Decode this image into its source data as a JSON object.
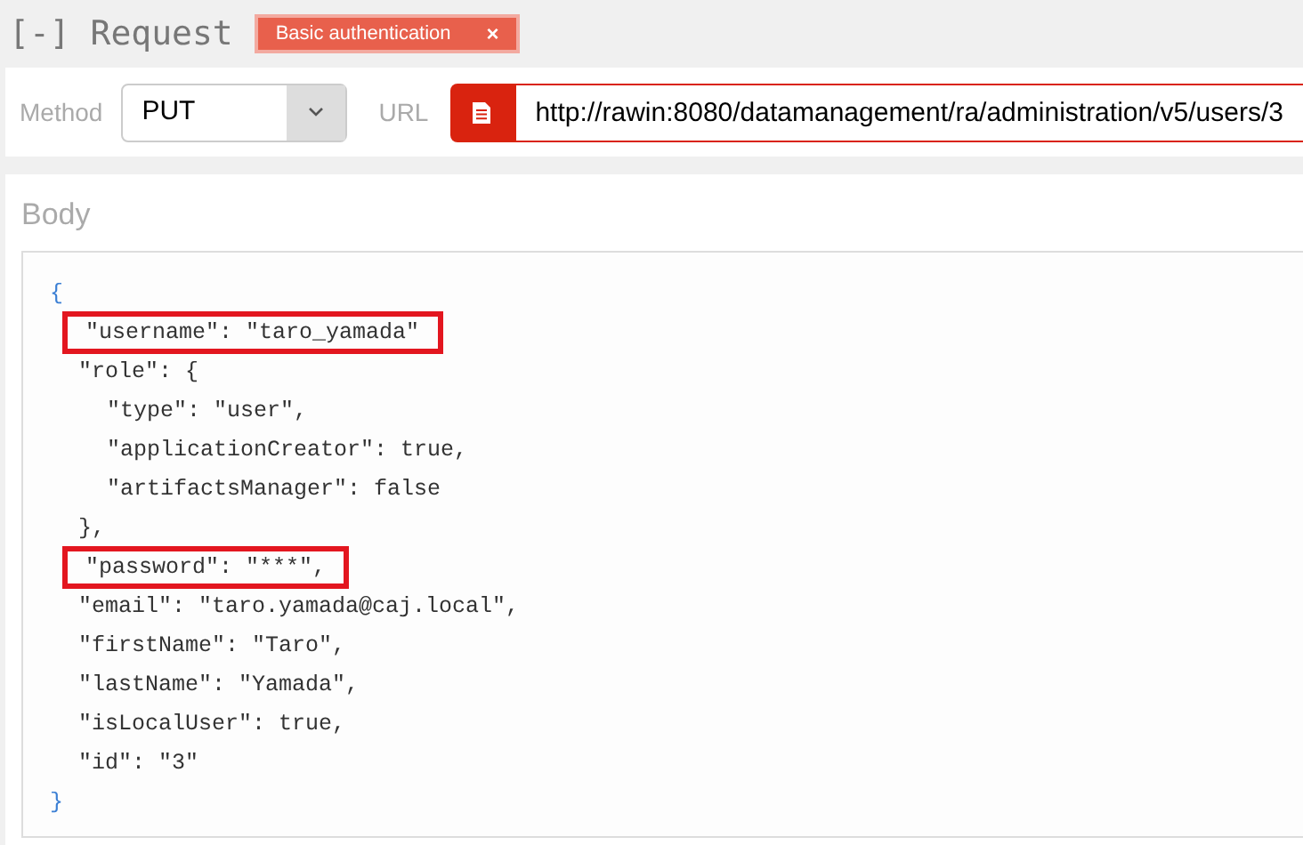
{
  "header": {
    "title": "[-] Request",
    "badge": {
      "label": "Basic authentication",
      "close": "×"
    }
  },
  "request": {
    "method_label": "Method",
    "method": "PUT",
    "url_label": "URL",
    "url": "http://rawin:8080/datamanagement/ra/administration/v5/users/3"
  },
  "body": {
    "title": "Body",
    "lines": [
      {
        "kind": "brace",
        "text": "{",
        "highlighted": false,
        "children": [
          {
            "kind": "entry",
            "text": "\"username\": \"taro_yamada\"",
            "highlighted": true
          },
          {
            "kind": "entry",
            "text": "\"role\": {",
            "highlighted": false,
            "children": [
              {
                "kind": "entry",
                "text": "\"type\": \"user\",",
                "highlighted": false
              },
              {
                "kind": "entry",
                "text": "\"applicationCreator\": true,",
                "highlighted": false
              },
              {
                "kind": "entry",
                "text": "\"artifactsManager\": false",
                "highlighted": false
              }
            ]
          },
          {
            "kind": "entry",
            "text": "},",
            "highlighted": false
          },
          {
            "kind": "entry",
            "text": "\"password\": \"***\",",
            "highlighted": true
          },
          {
            "kind": "entry",
            "text": "\"email\": \"taro.yamada@caj.local\",",
            "highlighted": false
          },
          {
            "kind": "entry",
            "text": "\"firstName\": \"Taro\",",
            "highlighted": false
          },
          {
            "kind": "entry",
            "text": "\"lastName\": \"Yamada\",",
            "highlighted": false
          },
          {
            "kind": "entry",
            "text": "\"isLocalUser\": true,",
            "highlighted": false
          },
          {
            "kind": "entry",
            "text": "\"id\": \"3\"",
            "highlighted": false
          }
        ]
      },
      {
        "kind": "brace",
        "text": "}",
        "highlighted": false
      }
    ]
  }
}
